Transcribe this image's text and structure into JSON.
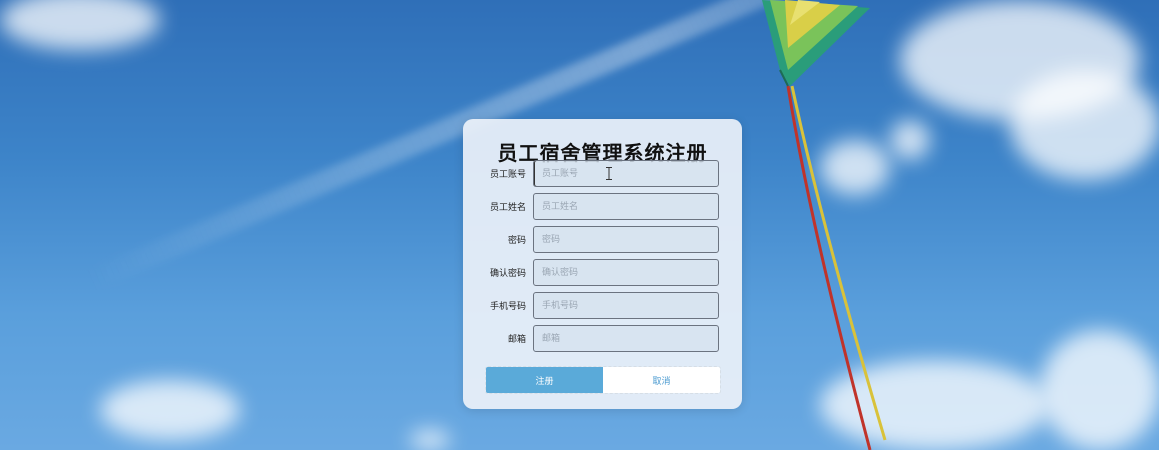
{
  "form": {
    "title": "员工宿舍管理系统注册",
    "fields": [
      {
        "label": "员工账号",
        "placeholder": "员工账号"
      },
      {
        "label": "员工姓名",
        "placeholder": "员工姓名"
      },
      {
        "label": "密码",
        "placeholder": "密码"
      },
      {
        "label": "确认密码",
        "placeholder": "确认密码"
      },
      {
        "label": "手机号码",
        "placeholder": "手机号码"
      },
      {
        "label": "邮箱",
        "placeholder": "邮箱"
      }
    ],
    "register_label": "注册",
    "cancel_label": "取消"
  },
  "colors": {
    "register_button": "#5aaad9",
    "cancel_text": "#4a9ad0"
  }
}
